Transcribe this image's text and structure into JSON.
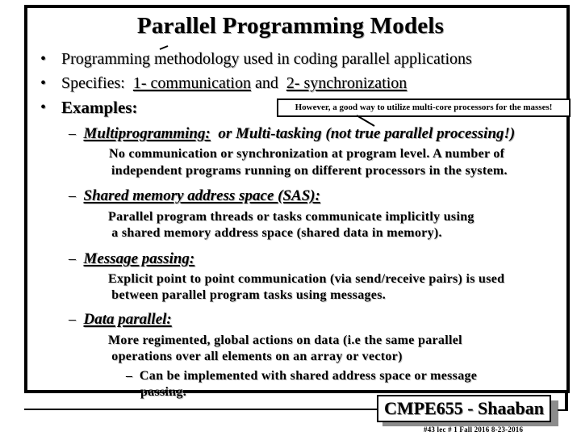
{
  "slide": {
    "title": "Parallel Programming Models",
    "bullets": [
      {
        "marker": "•",
        "text": "Programming methodology used in coding parallel applications"
      },
      {
        "marker": "•",
        "prefix": "Specifies:  ",
        "part1": "1- communication",
        "mid": " and  ",
        "part2": "2- synchronization"
      },
      {
        "marker": "•",
        "text": "Examples:"
      }
    ],
    "callout": "However, a good way to utilize multi-core processors for the masses!",
    "examples": [
      {
        "dash": "–",
        "heading": "Multiprogramming:",
        "heading_suffix": "  or Multi-tasking (not true parallel processing!)",
        "lines": [
          "No communication or synchronization at program level.  A number of",
          "independent programs running on different processors in the system."
        ]
      },
      {
        "dash": "–",
        "heading": "Shared memory address space (SAS):",
        "lines": [
          "Parallel program threads or tasks communicate implicitly using",
          " a shared memory address space (shared data in memory)."
        ]
      },
      {
        "dash": "–",
        "heading": "Message passing:",
        "lines": [
          "Explicit point to point communication (via send/receive pairs) is used",
          " between parallel program tasks using messages."
        ]
      },
      {
        "dash": "–",
        "heading": "Data parallel:",
        "lines": [
          "More regimented, global actions on data (i.e the same parallel",
          " operations over all elements on an array or vector)"
        ],
        "sub": {
          "dash": "–",
          "lines": [
            "Can be implemented with shared address space or message",
            "passing."
          ]
        }
      }
    ]
  },
  "footer": {
    "course": "CMPE655 - Shaaban",
    "meta": "#43   lec # 1   Fall 2016   8-23-2016"
  }
}
